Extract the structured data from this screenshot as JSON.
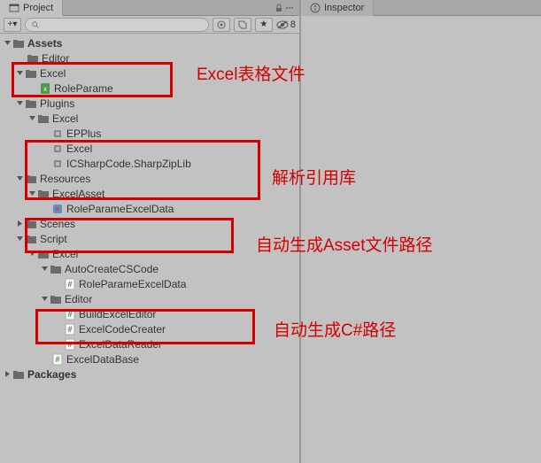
{
  "tabs": {
    "project": "Project",
    "inspector": "Inspector"
  },
  "toolbar": {
    "hidden_count": "8"
  },
  "tree": {
    "assets": "Assets",
    "editor": "Editor",
    "excel": "Excel",
    "roleparame": "RoleParame",
    "plugins": "Plugins",
    "excel2": "Excel",
    "epplus": "EPPlus",
    "excel3": "Excel",
    "icsharp": "ICSharpCode.SharpZipLib",
    "resources": "Resources",
    "excelasset": "ExcelAsset",
    "roleparame_excel_data": "RoleParameExcelData",
    "scenes": "Scenes",
    "script": "Script",
    "excel4": "Excel",
    "autocreate": "AutoCreateCSCode",
    "roleparame_excel_data2": "RoleParameExcelData",
    "editor2": "Editor",
    "build_excel_editor": "BuildExcelEditor",
    "excel_code_creater": "ExcelCodeCreater",
    "excel_data_reader": "ExcelDataReader",
    "excel_data_base": "ExcelDataBase",
    "packages": "Packages"
  },
  "annotations": {
    "a1": "Excel表格文件",
    "a2": "解析引用库",
    "a3": "自动生成Asset文件路径",
    "a4": "自动生成C#路径"
  }
}
